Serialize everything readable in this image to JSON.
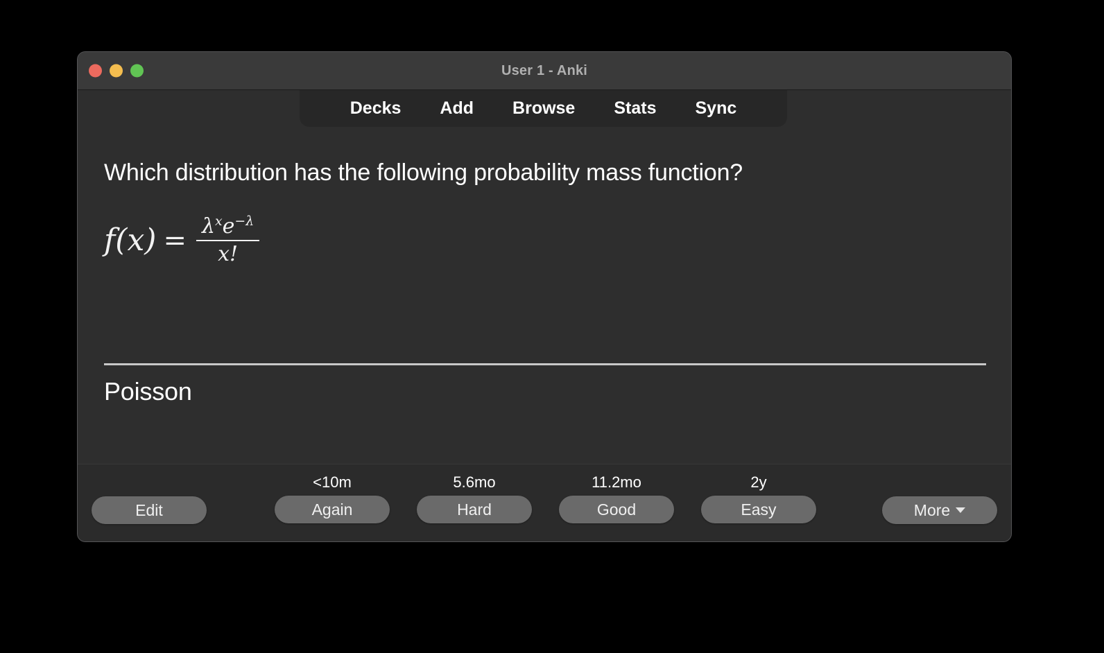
{
  "window": {
    "title": "User 1 - Anki",
    "traffic_lights": [
      {
        "name": "close",
        "color": "#ec6a5e"
      },
      {
        "name": "minimize",
        "color": "#f4bd4f"
      },
      {
        "name": "zoom",
        "color": "#61c454"
      }
    ]
  },
  "nav": {
    "items": [
      {
        "label": "Decks"
      },
      {
        "label": "Add"
      },
      {
        "label": "Browse"
      },
      {
        "label": "Stats"
      },
      {
        "label": "Sync"
      }
    ]
  },
  "card": {
    "question": "Which distribution has the following probability mass function?",
    "formula": {
      "lhs": "f(x)",
      "equals": "=",
      "numerator_base": "λ",
      "numerator_exp": "x",
      "numerator_e": "e",
      "numerator_e_exp": "−λ",
      "denominator": "x!",
      "plain": "f(x) = λ^x e^(−λ) / x!"
    },
    "answer": "Poisson"
  },
  "footer": {
    "edit_label": "Edit",
    "more_label": "More",
    "more_icon": "chevron-down-icon",
    "ease_buttons": [
      {
        "interval": "<10m",
        "label": "Again"
      },
      {
        "interval": "5.6mo",
        "label": "Hard"
      },
      {
        "interval": "11.2mo",
        "label": "Good"
      },
      {
        "interval": "2y",
        "label": "Easy"
      }
    ]
  }
}
